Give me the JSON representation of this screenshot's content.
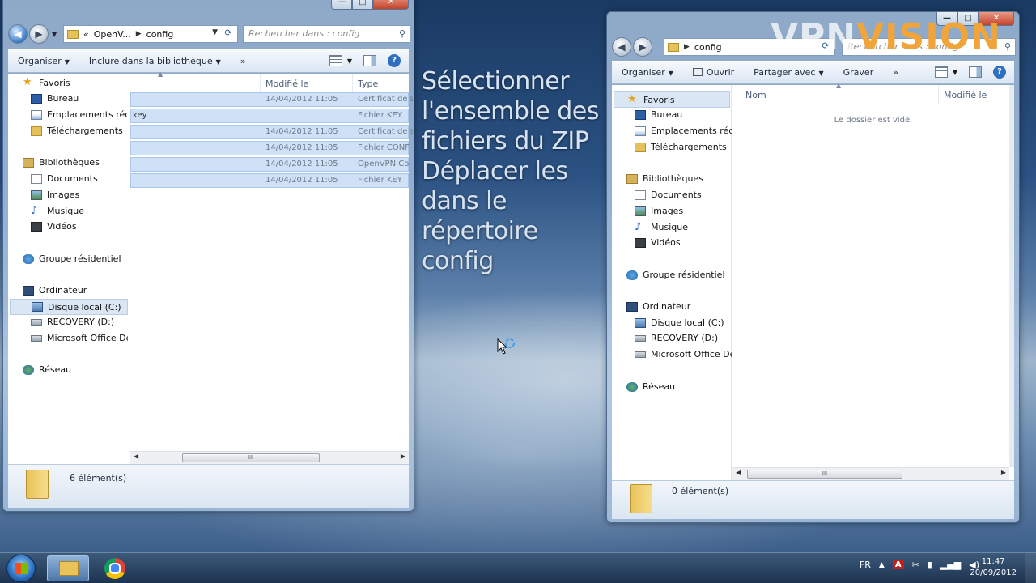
{
  "left_window": {
    "address": {
      "crumbs": [
        "OpenV...",
        "config"
      ],
      "prefix": "«"
    },
    "search_placeholder": "Rechercher dans : config",
    "toolbar": {
      "organize": "Organiser",
      "include": "Inclure dans la bibliothèque",
      "more": "»"
    },
    "columns": {
      "modified": "Modifié le",
      "type": "Type"
    },
    "files": [
      {
        "name": "",
        "modified": "14/04/2012 11:05",
        "type": "Certificat de s"
      },
      {
        "name": "key",
        "modified": "",
        "type": "Fichier KEY"
      },
      {
        "name": "",
        "modified": "14/04/2012 11:05",
        "type": "Certificat de s"
      },
      {
        "name": "",
        "modified": "14/04/2012 11:05",
        "type": "Fichier CONF"
      },
      {
        "name": "",
        "modified": "14/04/2012 11:05",
        "type": "OpenVPN Co"
      },
      {
        "name": "",
        "modified": "14/04/2012 11:05",
        "type": "Fichier KEY"
      }
    ],
    "status": "6 élément(s)"
  },
  "right_window": {
    "address": {
      "crumbs": [
        "config"
      ]
    },
    "search_placeholder": "Rechercher dans : config",
    "toolbar": {
      "organize": "Organiser",
      "open": "Ouvrir",
      "share": "Partager avec",
      "burn": "Graver",
      "more": "»"
    },
    "columns": {
      "name": "Nom",
      "modified": "Modifié le"
    },
    "empty_message": "Le dossier est vide.",
    "status": "0 élément(s)"
  },
  "nav": {
    "favorites": "Favoris",
    "desktop": "Bureau",
    "recent": "Emplacements récents",
    "downloads": "Téléchargements",
    "libraries": "Bibliothèques",
    "documents": "Documents",
    "images": "Images",
    "music": "Musique",
    "videos": "Vidéos",
    "homegroup": "Groupe résidentiel",
    "computer": "Ordinateur",
    "drive_c": "Disque local (C:)",
    "drive_d": "RECOVERY (D:)",
    "drive_office": "Microsoft Office Démarrer en un clic",
    "network": "Réseau"
  },
  "overlay": {
    "lines": [
      "Sélectionner",
      "l'ensemble des",
      "fichiers du ZIP",
      "Déplacer les",
      "dans le",
      "répertoire",
      "config"
    ]
  },
  "logo": {
    "part1": "VPN",
    "part2": "VISION"
  },
  "taskbar": {
    "lang": "FR",
    "adobe": "A",
    "time": "11:47",
    "date": "20/09/2012"
  },
  "colors": {
    "accent": "#f0a43a",
    "selection": "#cfe1f6",
    "window_glass": "#afc8e4"
  }
}
